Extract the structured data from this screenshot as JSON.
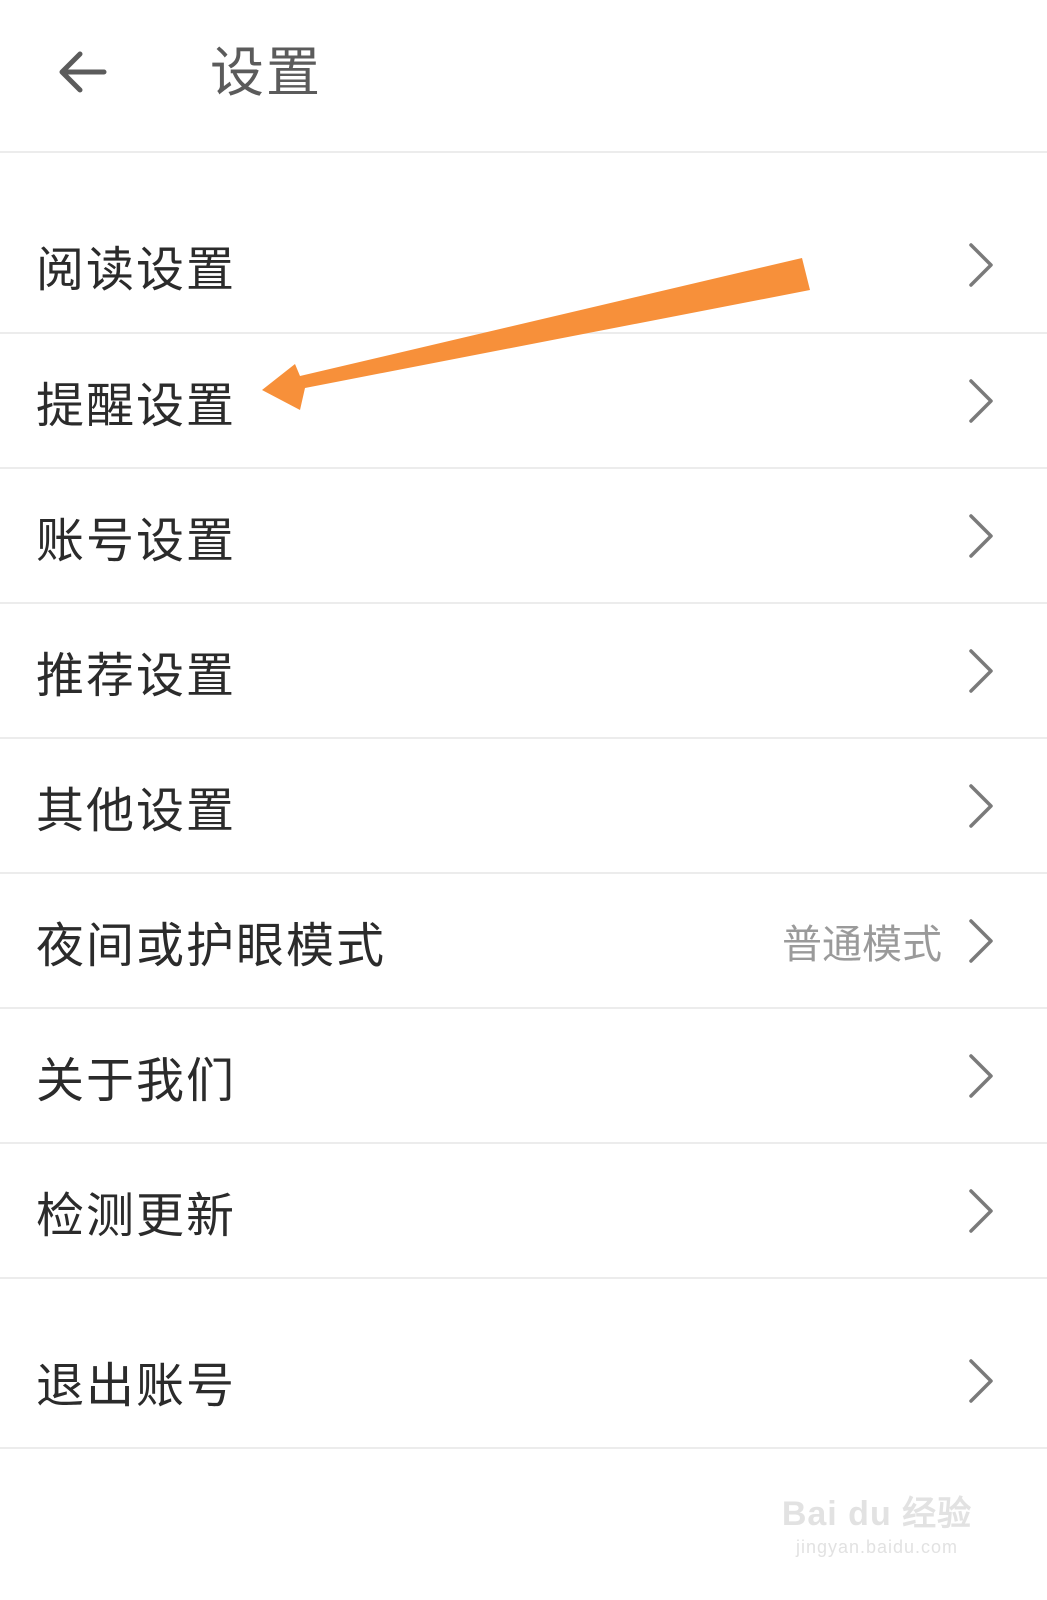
{
  "header": {
    "title": "设置",
    "back_icon": "arrow-left-icon"
  },
  "menu": {
    "items": [
      {
        "label": "阅读设置",
        "value": ""
      },
      {
        "label": "提醒设置",
        "value": ""
      },
      {
        "label": "账号设置",
        "value": ""
      },
      {
        "label": "推荐设置",
        "value": ""
      },
      {
        "label": "其他设置",
        "value": ""
      },
      {
        "label": "夜间或护眼模式",
        "value": "普通模式"
      },
      {
        "label": "关于我们",
        "value": ""
      },
      {
        "label": "检测更新",
        "value": ""
      }
    ],
    "chevron_icon": "chevron-right-icon"
  },
  "logout": {
    "label": "退出账号"
  },
  "annotation": {
    "color": "#F7903A",
    "points_to": "提醒设置"
  },
  "watermark": {
    "logo": "Bai du 经验",
    "url": "jingyan.baidu.com"
  }
}
